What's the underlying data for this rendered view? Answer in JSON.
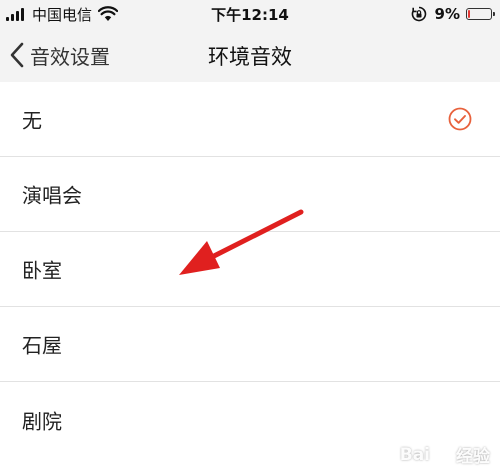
{
  "status_bar": {
    "carrier": "中国电信",
    "time": "下午12:14",
    "battery_percent": "9%",
    "battery_level": 0.09,
    "icons": [
      "signal-icon",
      "wifi-icon",
      "orientation-lock-icon",
      "battery-icon"
    ]
  },
  "nav": {
    "back_label": "音效设置",
    "title": "环境音效"
  },
  "list": {
    "items": [
      {
        "label": "无",
        "selected": true
      },
      {
        "label": "演唱会",
        "selected": false
      },
      {
        "label": "卧室",
        "selected": false
      },
      {
        "label": "石屋",
        "selected": false
      },
      {
        "label": "剧院",
        "selected": false
      }
    ]
  },
  "colors": {
    "accent": "#e8613c",
    "arrow": "#e0201f",
    "bar_background": "#f3f3f3",
    "divider": "#e2e2e2"
  },
  "watermark": {
    "brand": "Bai",
    "suffix": "经验"
  }
}
